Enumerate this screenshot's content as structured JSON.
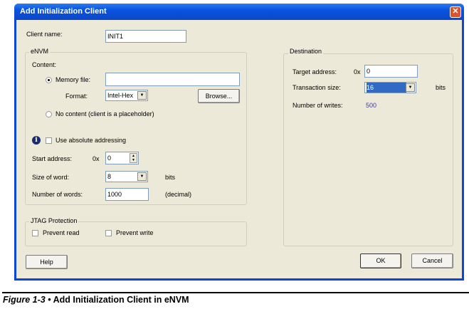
{
  "dialog": {
    "title": "Add Initialization Client",
    "close": "✕"
  },
  "client_name": {
    "label": "Client name:",
    "value": "INIT1"
  },
  "envm": {
    "group": "eNVM",
    "content_label": "Content:",
    "memory_file": {
      "label": "Memory file:",
      "value": "",
      "selected": true
    },
    "format": {
      "label": "Format:",
      "value": "Intel-Hex"
    },
    "browse": "Browse...",
    "no_content": {
      "label": "No content (client is a placeholder)",
      "selected": false
    },
    "absolute": {
      "label": "Use absolute addressing",
      "checked": false
    },
    "start_address": {
      "label": "Start address:",
      "prefix": "0x",
      "value": "0"
    },
    "size_of_word": {
      "label": "Size of word:",
      "value": "8",
      "unit": "bits"
    },
    "number_of_words": {
      "label": "Number of words:",
      "value": "1000",
      "unit": "(decimal)"
    }
  },
  "jtag": {
    "group": "JTAG Protection",
    "prevent_read": "Prevent read",
    "prevent_write": "Prevent write"
  },
  "destination": {
    "group": "Destination",
    "target_address": {
      "label": "Target address:",
      "prefix": "0x",
      "value": "0"
    },
    "transaction_size": {
      "label": "Transaction size:",
      "value": "16",
      "unit": "bits"
    },
    "number_of_writes": {
      "label": "Number of writes:",
      "value": "500"
    }
  },
  "buttons": {
    "help": "Help",
    "ok": "OK",
    "cancel": "Cancel"
  },
  "caption": {
    "figure": "Figure 1-3",
    "text": " • Add Initialization Client in eNVM"
  },
  "colors": {
    "titlebar": "#0a52de",
    "value_link": "#3a3aa8",
    "selection": "#316ac5"
  }
}
